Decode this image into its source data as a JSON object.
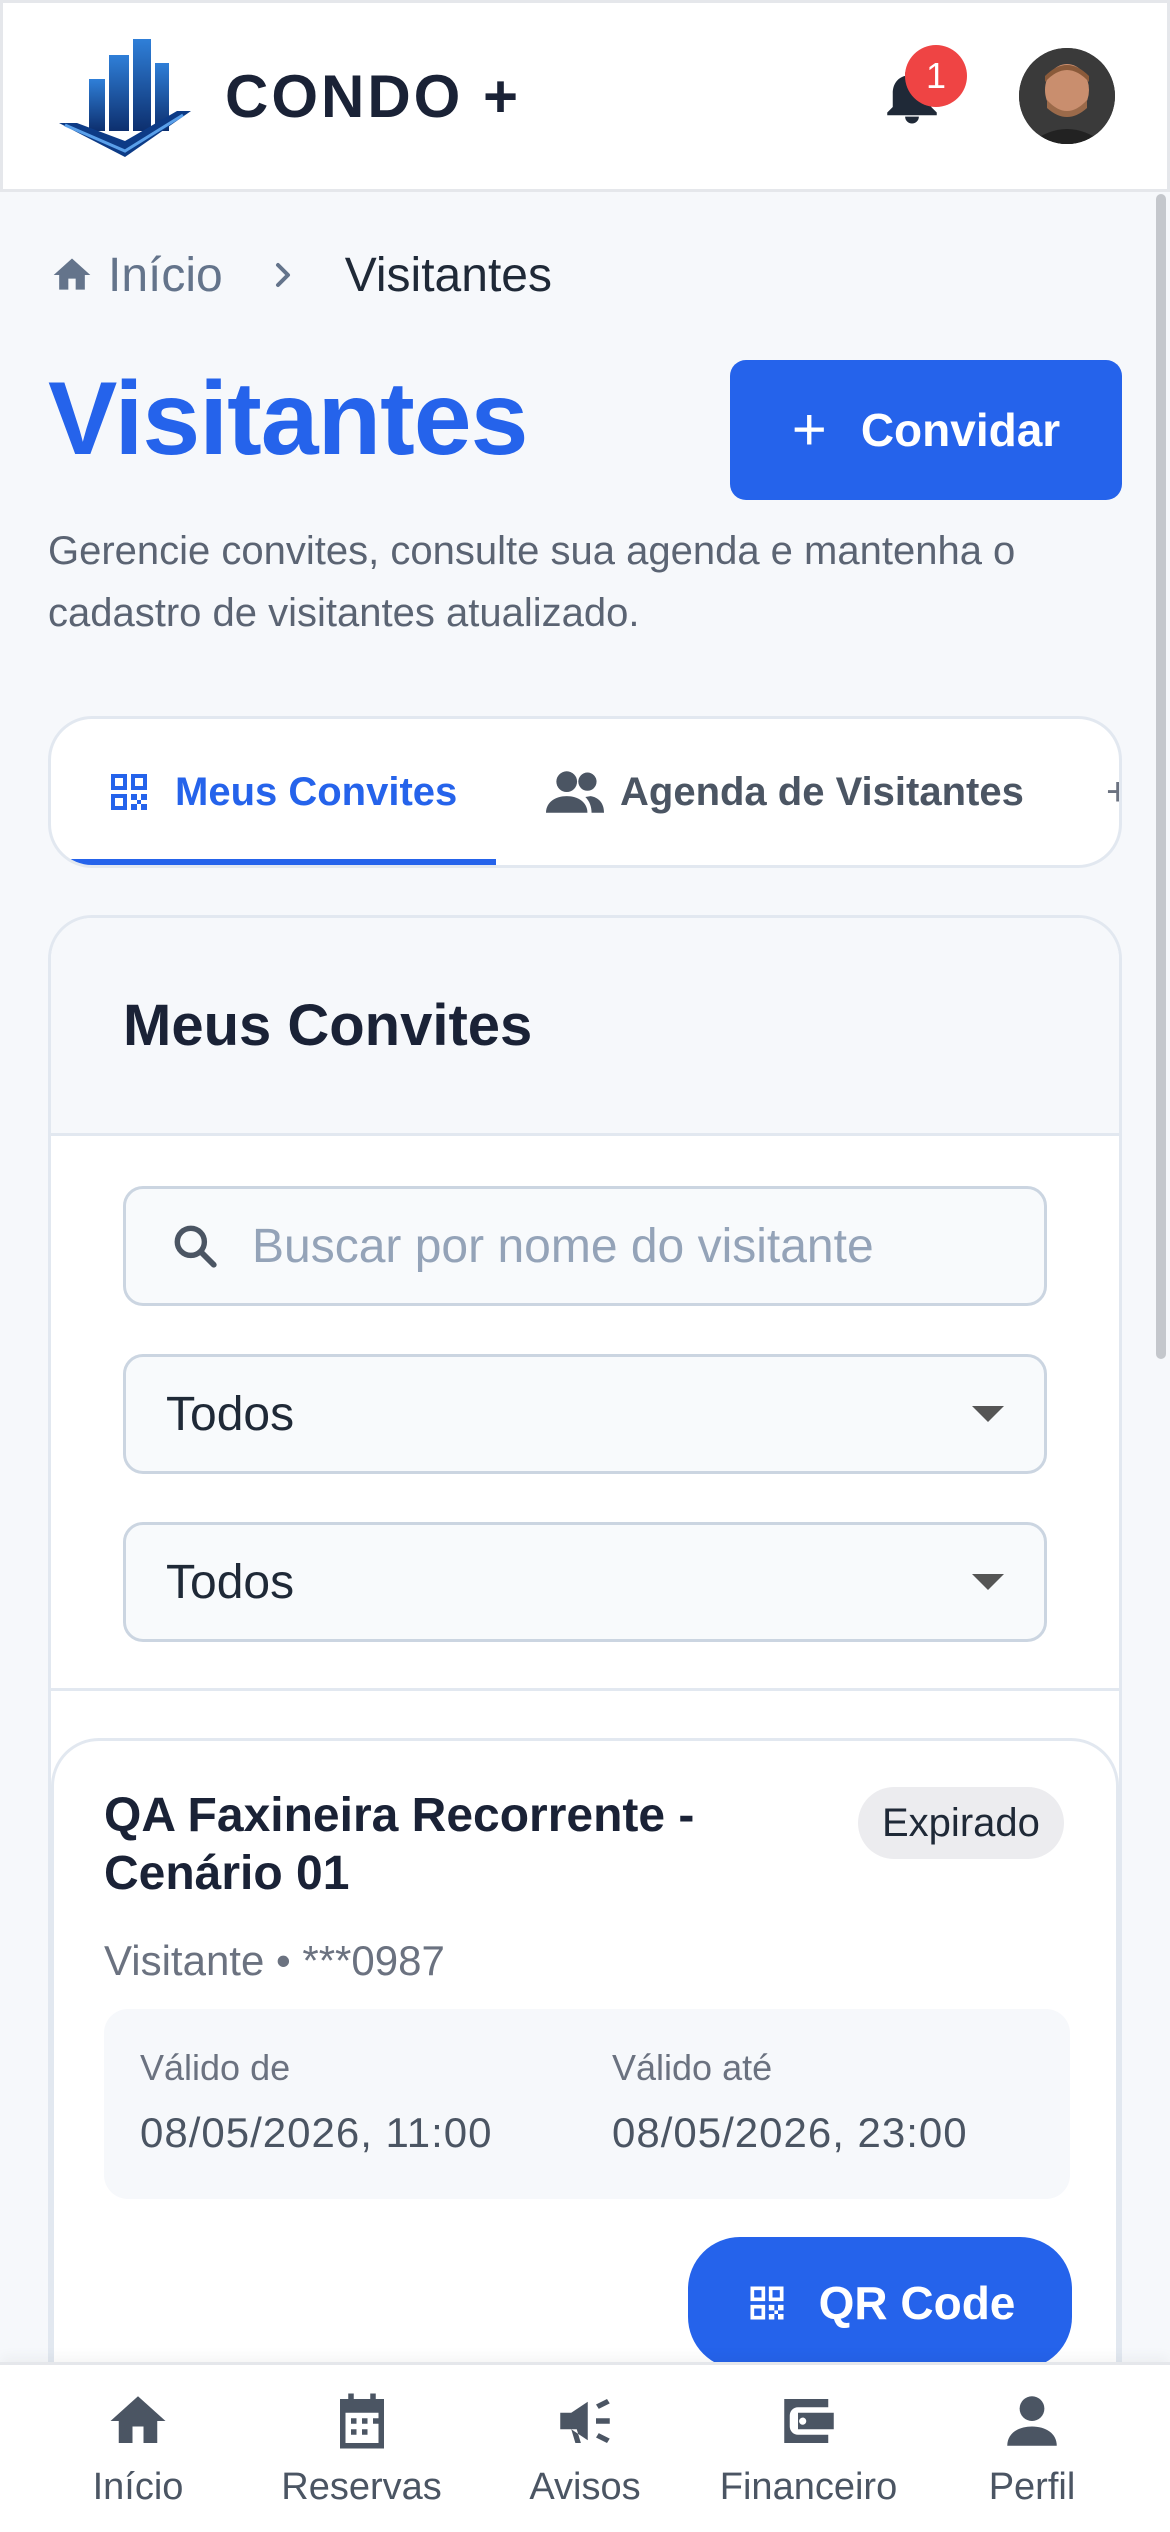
{
  "header": {
    "brand": "CONDO +",
    "notification_count": "1",
    "icons": {
      "logo": "building-logo-icon",
      "bell": "bell-icon",
      "avatar": "user-avatar"
    }
  },
  "breadcrumb": {
    "home": "Início",
    "current": "Visitantes"
  },
  "page": {
    "title": "Visitantes",
    "invite_button": "Convidar",
    "subtitle": "Gerencie convites, consulte sua agenda e mantenha o cadastro de visitantes atualizado."
  },
  "tabs": [
    {
      "label": "Meus Convites",
      "icon": "qr-code-icon",
      "active": true
    },
    {
      "label": "Agenda de Visitantes",
      "icon": "people-icon",
      "active": false
    }
  ],
  "panel": {
    "title": "Meus Convites",
    "search_placeholder": "Buscar por nome do visitante",
    "filter_1": "Todos",
    "filter_2": "Todos"
  },
  "invites": [
    {
      "name": "QA Faxineira Recorrente - Cenário 01",
      "status": "Expirado",
      "meta": "Visitante • ***0987",
      "valid_from_label": "Válido de",
      "valid_from": "08/05/2026, 11:00",
      "valid_to_label": "Válido até",
      "valid_to": "08/05/2026, 23:00",
      "qr_button": "QR Code"
    }
  ],
  "bottom_nav": [
    {
      "label": "Início",
      "icon": "home-icon"
    },
    {
      "label": "Reservas",
      "icon": "calendar-icon"
    },
    {
      "label": "Avisos",
      "icon": "megaphone-icon"
    },
    {
      "label": "Financeiro",
      "icon": "wallet-icon"
    },
    {
      "label": "Perfil",
      "icon": "person-icon"
    }
  ],
  "colors": {
    "primary": "#2563eb",
    "text_dark": "#1a2236",
    "muted": "#6b7280",
    "badge_red": "#ef4444",
    "background": "#f6f8fb"
  }
}
